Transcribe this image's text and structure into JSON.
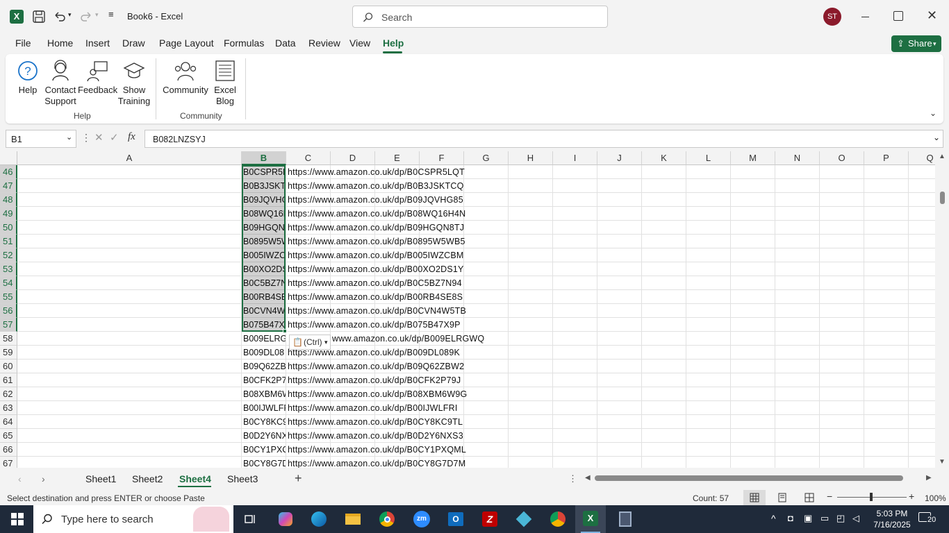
{
  "app": {
    "title": "Book6  -  Excel",
    "user_initials": "ST",
    "avatar_color": "#8b1a2b",
    "accent": "#217346"
  },
  "search": {
    "placeholder": "Search"
  },
  "window": {
    "minimize_icon": "minimize-icon",
    "restore_icon": "restore-icon",
    "close_icon": "close-icon"
  },
  "menu_tabs": [
    "File",
    "Home",
    "Insert",
    "Draw",
    "Page Layout",
    "Formulas",
    "Data",
    "Review",
    "View",
    "Help"
  ],
  "active_tab": "Help",
  "share_label": "Share",
  "ribbon": {
    "help_group": {
      "label": "Help",
      "buttons": [
        {
          "line1": "Help",
          "line2": "",
          "icon": "help-icon"
        },
        {
          "line1": "Contact",
          "line2": "Support",
          "icon": "contact-support-icon"
        },
        {
          "line1": "Feedback",
          "line2": "",
          "icon": "feedback-icon"
        },
        {
          "line1": "Show",
          "line2": "Training",
          "icon": "training-icon"
        }
      ]
    },
    "community_group": {
      "label": "Community",
      "buttons": [
        {
          "line1": "Community",
          "line2": "",
          "icon": "community-icon"
        },
        {
          "line1": "Excel",
          "line2": "Blog",
          "icon": "blog-icon"
        }
      ]
    }
  },
  "formula_bar": {
    "name_box": "B1",
    "fx": "fx",
    "formula": "B082LNZSYJ"
  },
  "columns": [
    "A",
    "B",
    "C",
    "D",
    "E",
    "F",
    "G",
    "H",
    "I",
    "J",
    "K",
    "L",
    "M",
    "N",
    "O",
    "P",
    "Q"
  ],
  "rows": [
    {
      "num": "46",
      "b": "B0CSPR5L",
      "c": "https://www.amazon.co.uk/dp/B0CSPR5LQT"
    },
    {
      "num": "47",
      "b": "B0B3JSKTC",
      "c": "https://www.amazon.co.uk/dp/B0B3JSKTCQ"
    },
    {
      "num": "48",
      "b": "B09JQVHG",
      "c": "https://www.amazon.co.uk/dp/B09JQVHG85"
    },
    {
      "num": "49",
      "b": "B08WQ16H",
      "c": "https://www.amazon.co.uk/dp/B08WQ16H4N"
    },
    {
      "num": "50",
      "b": "B09HGQN",
      "c": "https://www.amazon.co.uk/dp/B09HGQN8TJ"
    },
    {
      "num": "51",
      "b": "B0895W5W",
      "c": "https://www.amazon.co.uk/dp/B0895W5WB5"
    },
    {
      "num": "52",
      "b": "B005IWZC",
      "c": "https://www.amazon.co.uk/dp/B005IWZCBM"
    },
    {
      "num": "53",
      "b": "B00XO2DS",
      "c": "https://www.amazon.co.uk/dp/B00XO2DS1Y"
    },
    {
      "num": "54",
      "b": "B0C5BZ7N",
      "c": "https://www.amazon.co.uk/dp/B0C5BZ7N94"
    },
    {
      "num": "55",
      "b": "B00RB4SE",
      "c": "https://www.amazon.co.uk/dp/B00RB4SE8S"
    },
    {
      "num": "56",
      "b": "B0CVN4W",
      "c": "https://www.amazon.co.uk/dp/B0CVN4W5TB"
    },
    {
      "num": "57",
      "b": "B075B47X",
      "c": "https://www.amazon.co.uk/dp/B075B47X9P"
    },
    {
      "num": "58",
      "b": "B009ELRG",
      "c": "www.amazon.co.uk/dp/B009ELRGWQ"
    },
    {
      "num": "59",
      "b": "B009DL08",
      "c": "https://www.amazon.co.uk/dp/B009DL089K"
    },
    {
      "num": "60",
      "b": "B09Q62ZB",
      "c": "https://www.amazon.co.uk/dp/B09Q62ZBW2"
    },
    {
      "num": "61",
      "b": "B0CFK2P7",
      "c": "https://www.amazon.co.uk/dp/B0CFK2P79J"
    },
    {
      "num": "62",
      "b": "B08XBM6W",
      "c": "https://www.amazon.co.uk/dp/B08XBM6W9G"
    },
    {
      "num": "63",
      "b": "B00IJWLFR",
      "c": "https://www.amazon.co.uk/dp/B00IJWLFRI"
    },
    {
      "num": "64",
      "b": "B0CY8KC9",
      "c": "https://www.amazon.co.uk/dp/B0CY8KC9TL"
    },
    {
      "num": "65",
      "b": "B0D2Y6NX",
      "c": "https://www.amazon.co.uk/dp/B0D2Y6NXS3"
    },
    {
      "num": "66",
      "b": "B0CY1PXC",
      "c": "https://www.amazon.co.uk/dp/B0CY1PXQML"
    },
    {
      "num": "67",
      "b": "B0CY8G7D",
      "c": "https://www.amazon.co.uk/dp/B0CY8G7D7M"
    }
  ],
  "paste_options": {
    "label": "(Ctrl)"
  },
  "sheets": [
    "Sheet1",
    "Sheet2",
    "Sheet4",
    "Sheet3"
  ],
  "active_sheet": "Sheet4",
  "status": {
    "message": "Select destination and press ENTER or choose Paste",
    "count": "Count: 57",
    "zoom": "100%"
  },
  "taskbar": {
    "search_placeholder": "Type here to search",
    "time": "5:03 PM",
    "date": "7/16/2025",
    "notification_count": "20"
  }
}
